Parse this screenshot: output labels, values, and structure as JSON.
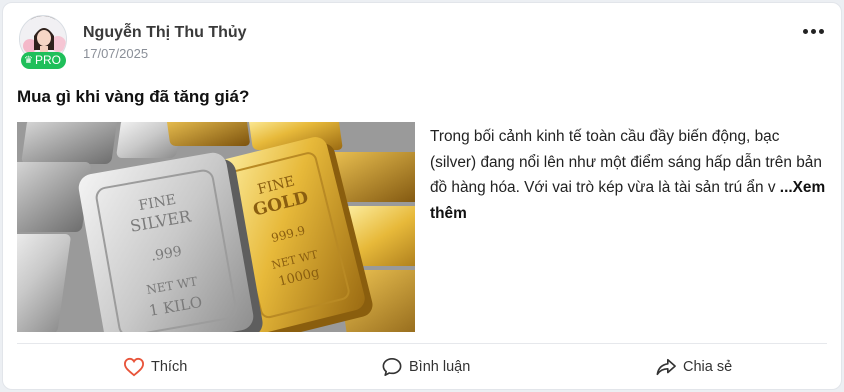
{
  "post": {
    "author": {
      "name": "Nguyễn Thị Thu Thủy",
      "badge": "PRO",
      "badge_color": "#1fbf5a"
    },
    "date": "17/07/2025",
    "title": "Mua gì khi vàng đã tăng giá?",
    "excerpt": "Trong bối cảnh kinh tế toàn cầu đầy biến động, bạc (silver) đang nổi lên như một điểm sáng hấp dẫn trên bản đồ hàng hóa. Với vai trò kép vừa là tài sản trú ẩn v",
    "see_more": " ...Xem thêm",
    "image": {
      "silver_bar_text": [
        "FINE",
        "SILVER",
        ".999",
        "NET WT",
        "1 KILO"
      ],
      "gold_bar_text": [
        "FINE",
        "GOLD",
        "999.9",
        "NET WT",
        "1000g"
      ]
    }
  },
  "actions": [
    {
      "label": "Thích",
      "icon": "heart-icon"
    },
    {
      "label": "Bình luận",
      "icon": "comment-icon"
    },
    {
      "label": "Chia sẻ",
      "icon": "share-icon"
    }
  ],
  "menu_icon": "more-dots-icon",
  "accent": "#e8543a"
}
